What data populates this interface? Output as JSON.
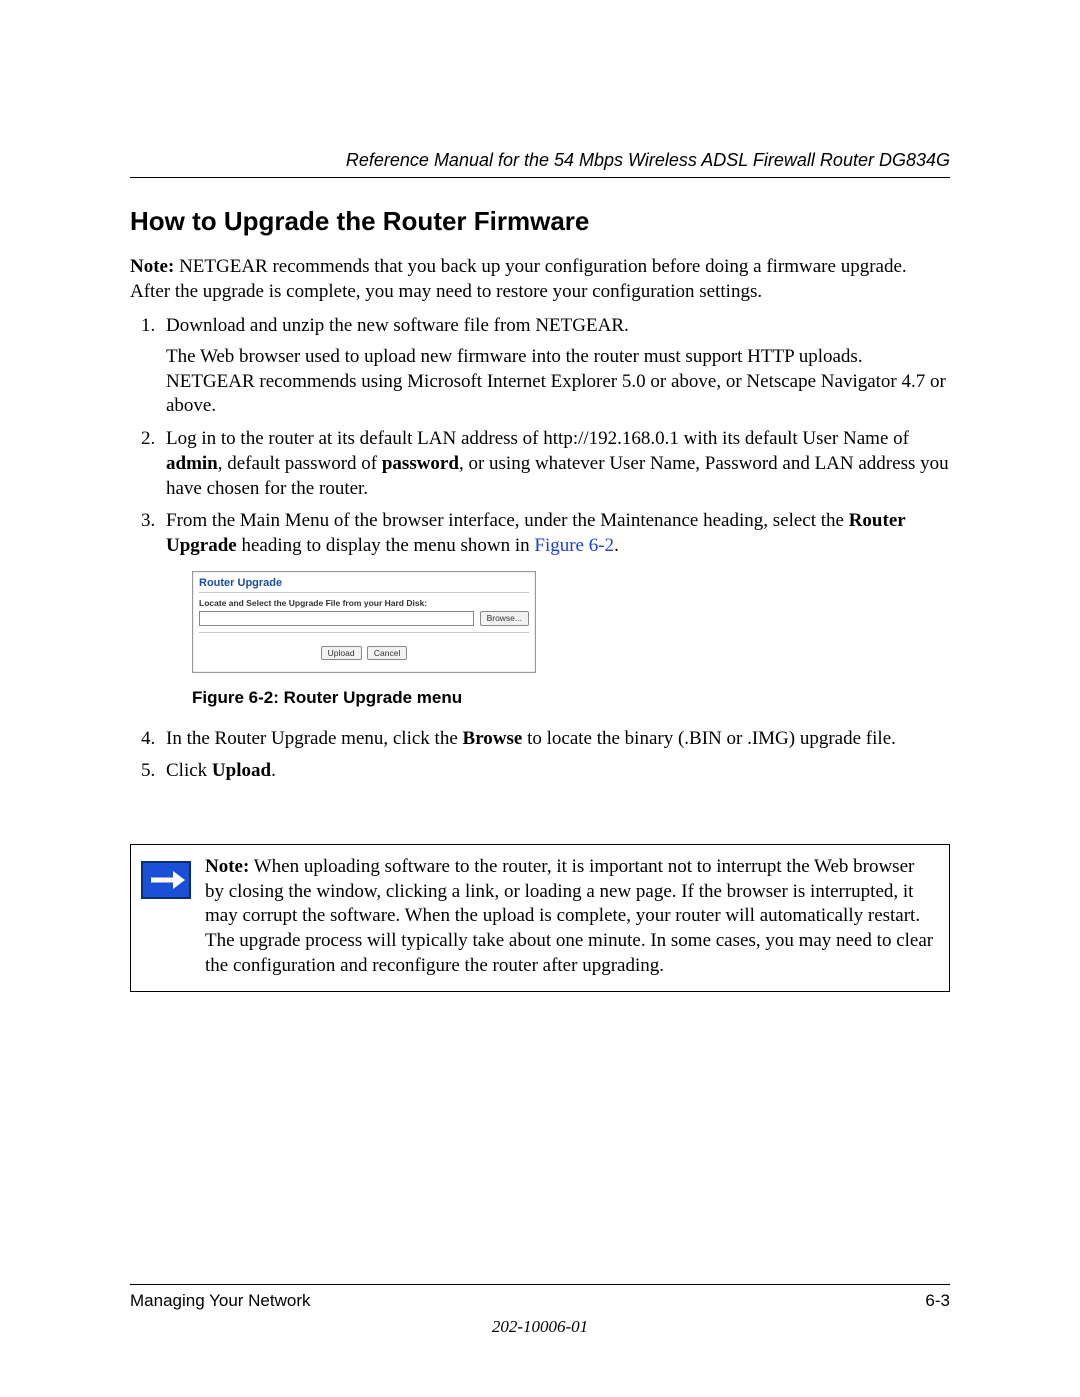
{
  "header": {
    "running_title": "Reference Manual for the 54 Mbps Wireless ADSL Firewall Router DG834G"
  },
  "section": {
    "title": "How to Upgrade the Router Firmware",
    "note_label": "Note:",
    "note_text": " NETGEAR recommends that you back up your configuration before doing a firmware upgrade. After the upgrade is complete, you may need to restore your configuration settings."
  },
  "steps": {
    "s1_main": "Download and unzip the new software file from NETGEAR.",
    "s1_sub": "The Web browser used to upload new firmware into the router must support HTTP uploads. NETGEAR recommends using Microsoft Internet Explorer 5.0 or above, or Netscape Navigator 4.7 or above.",
    "s2_a": "Log in to the router at its default LAN address of http://192.168.0.1 with its default User Name of ",
    "s2_bold1": "admin",
    "s2_b": ", default password of ",
    "s2_bold2": "password",
    "s2_c": ", or using whatever User Name, Password and LAN address you have chosen for the router.",
    "s3_a": "From the Main Menu of the browser interface, under the Maintenance heading, select the ",
    "s3_bold": "Router Upgrade",
    "s3_b": " heading to display the menu shown in ",
    "s3_link": "Figure 6-2",
    "s3_c": ".",
    "s4_a": "In the Router Upgrade menu, click the ",
    "s4_bold": "Browse",
    "s4_b": " to locate the binary (.BIN or .IMG) upgrade file.",
    "s5_a": "Click ",
    "s5_bold": "Upload",
    "s5_b": "."
  },
  "figure": {
    "caption": "Figure 6-2:  Router Upgrade menu",
    "ui": {
      "title": "Router Upgrade",
      "label": "Locate and Select the Upgrade File from your Hard Disk:",
      "browse": "Browse...",
      "upload": "Upload",
      "cancel": "Cancel"
    }
  },
  "callout": {
    "label": "Note:",
    "text": " When uploading software to the router, it is important not to interrupt the Web browser by closing the window, clicking a link, or loading a new page. If the browser is interrupted, it may corrupt the software. When the upload is complete, your router will automatically restart. The upgrade process will typically take about one minute. In some cases, you may need to clear the configuration and reconfigure the router after upgrading."
  },
  "footer": {
    "left": "Managing Your Network",
    "right": "6-3",
    "docnum": "202-10006-01"
  }
}
